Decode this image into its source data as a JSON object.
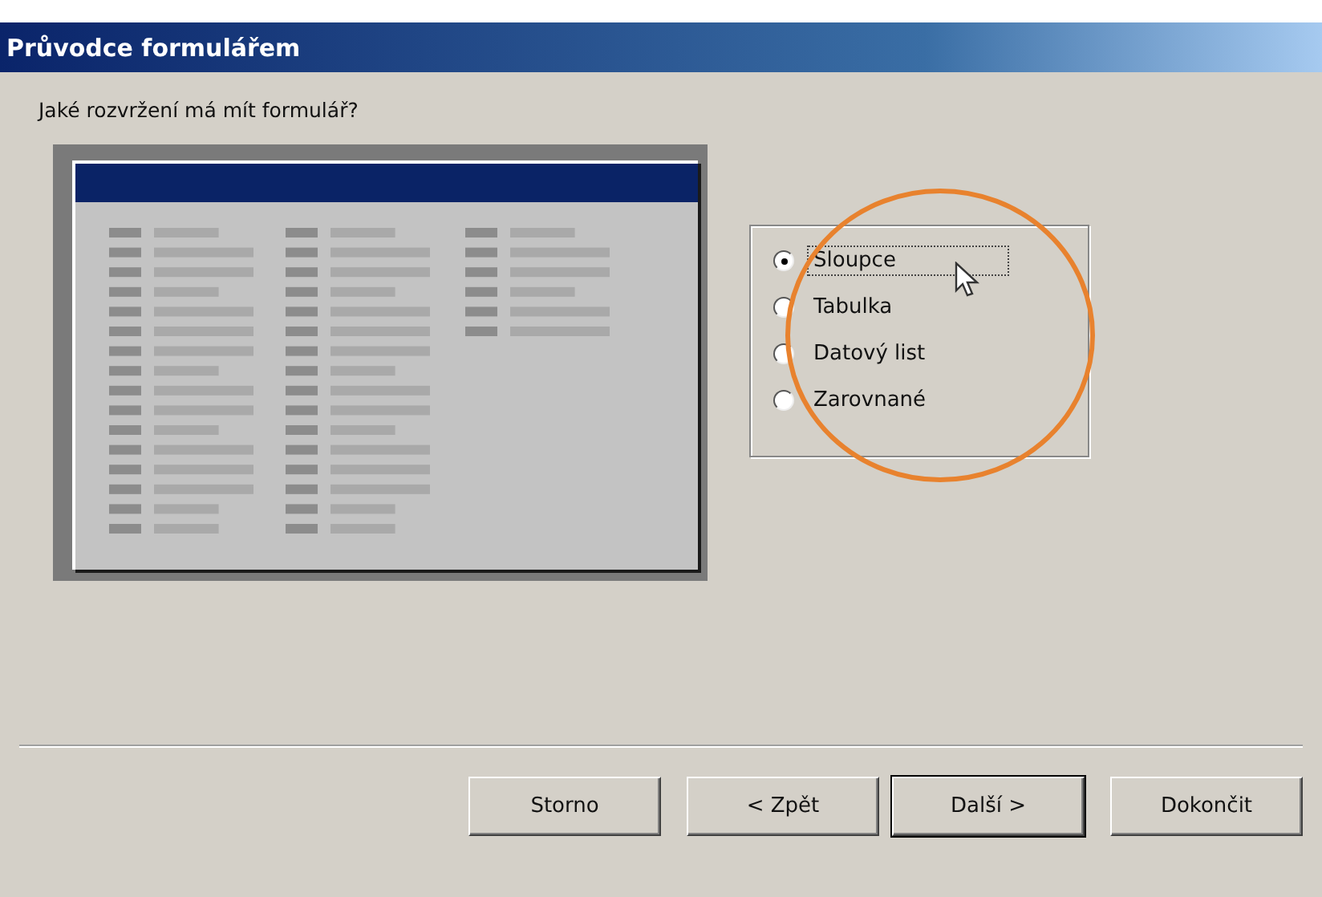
{
  "window": {
    "title": "Průvodce formulářem"
  },
  "question": "Jaké rozvržení má mít formulář?",
  "layout_options": [
    {
      "label": "Sloupce",
      "selected": true
    },
    {
      "label": "Tabulka",
      "selected": false
    },
    {
      "label": "Datový list",
      "selected": false
    },
    {
      "label": "Zarovnané",
      "selected": false
    }
  ],
  "buttons": [
    {
      "label": "Storno",
      "default": false
    },
    {
      "label": "< Zpět",
      "default": false
    },
    {
      "label": "Další >",
      "default": true
    },
    {
      "label": "Dokončit",
      "default": false
    }
  ]
}
